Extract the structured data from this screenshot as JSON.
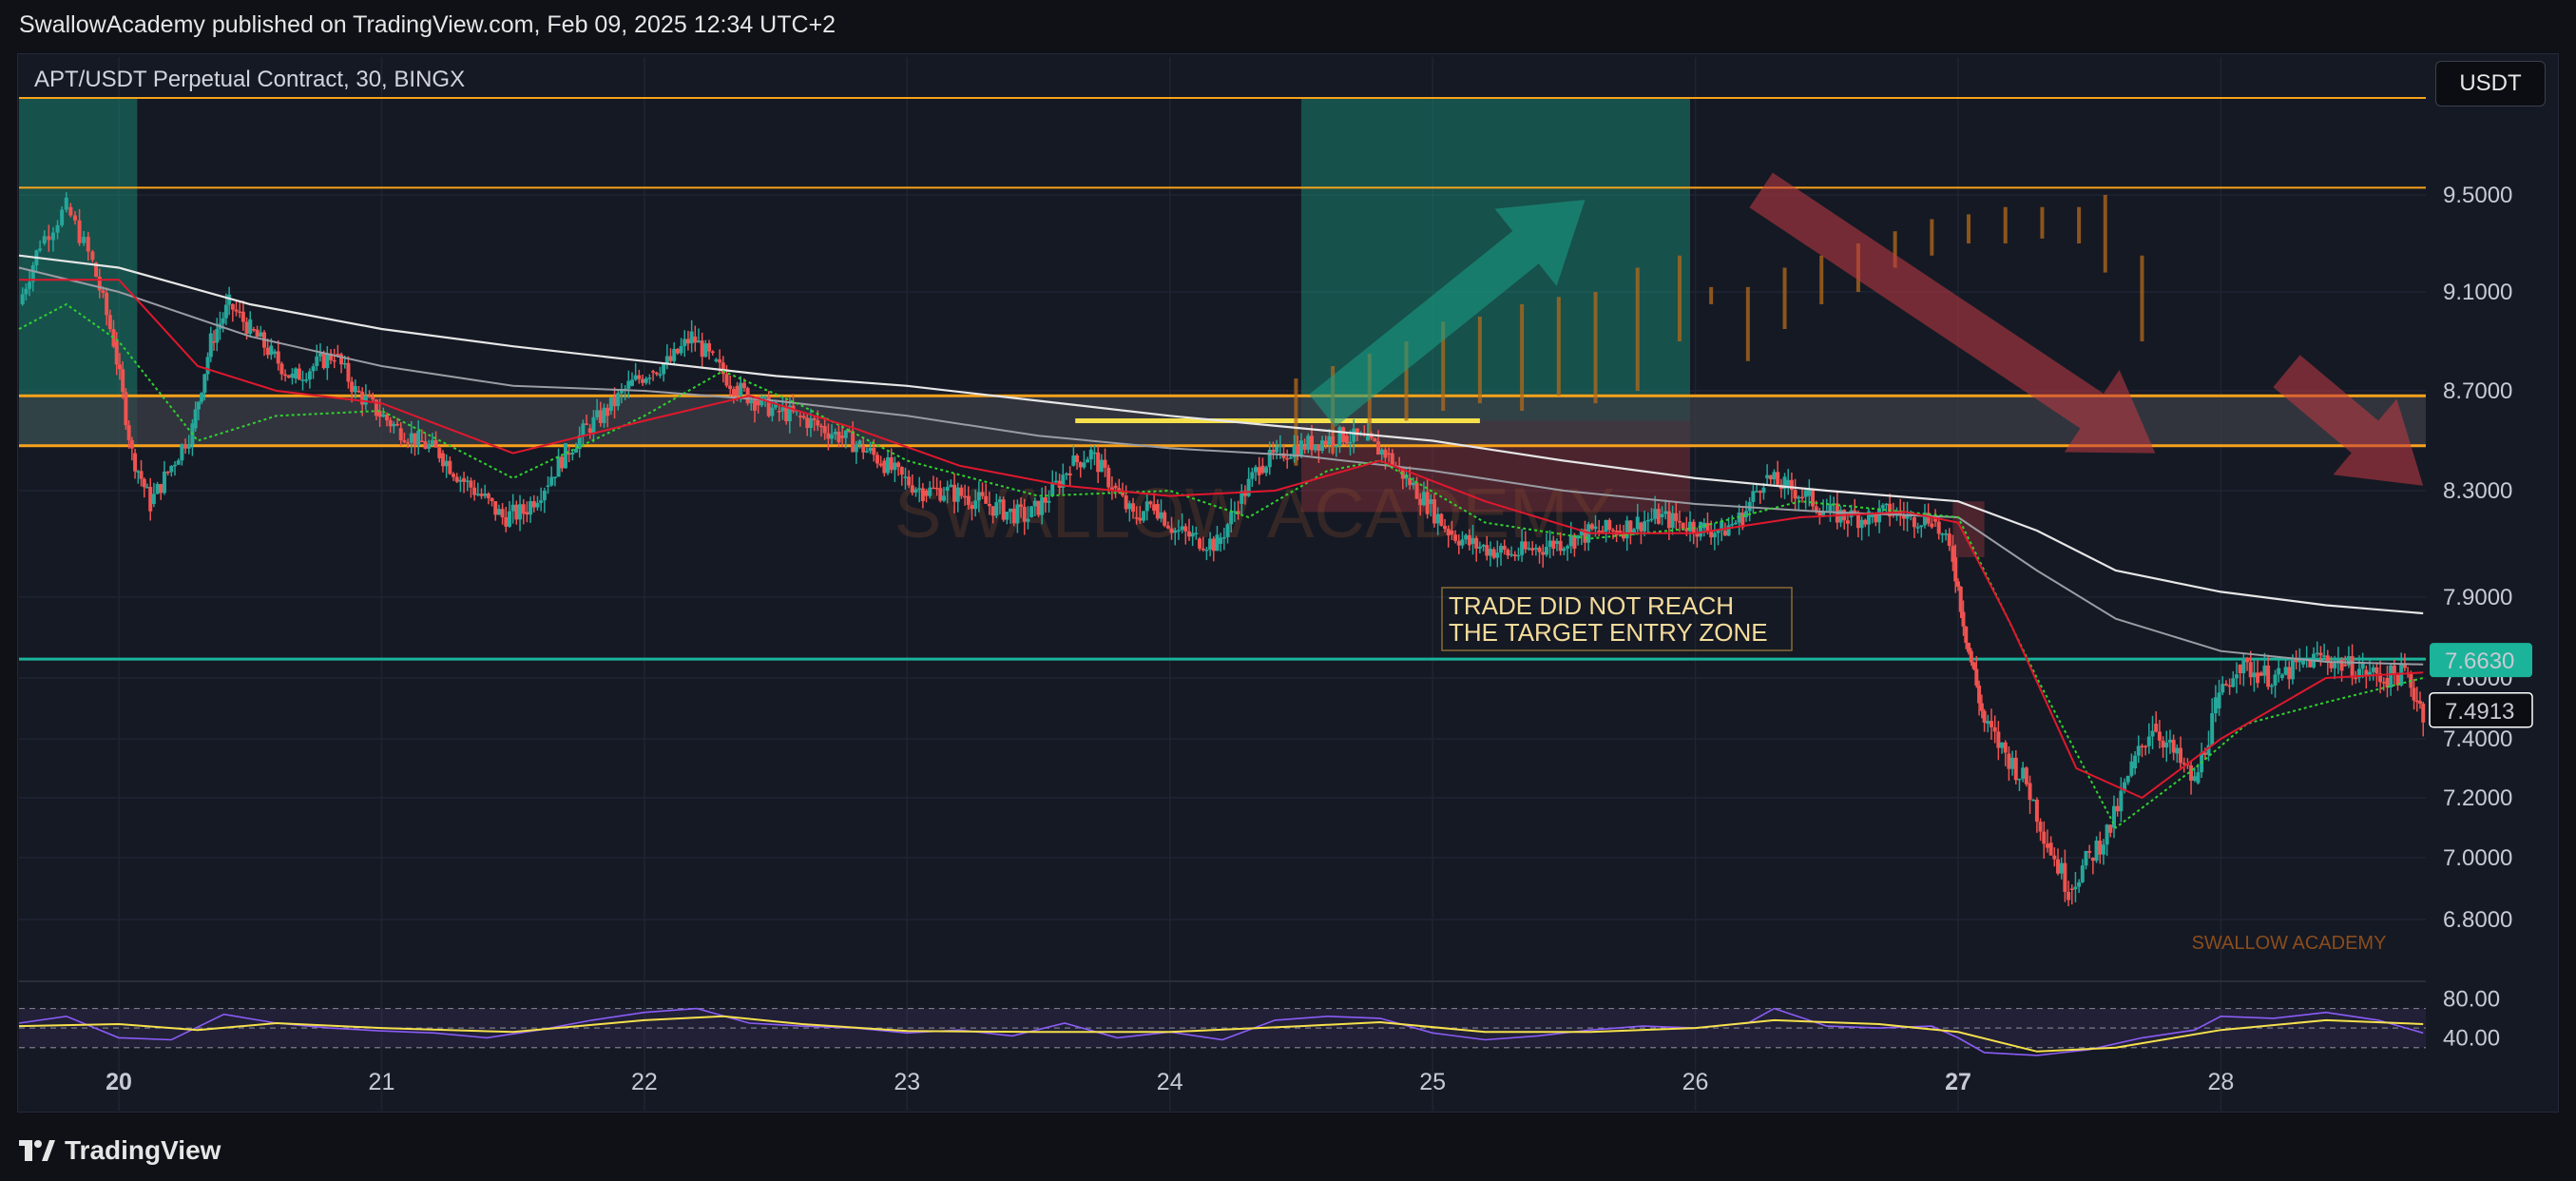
{
  "header": {
    "published_line": "SwallowAcademy published on TradingView.com, Feb 09, 2025 12:34 UTC+2"
  },
  "chart_header": {
    "symbol": "APT/USDT Perpetual Contract, 30, BINGX",
    "currency_button": "USDT"
  },
  "footer": {
    "brand": "TradingView"
  },
  "annotations": {
    "note_line1": "TRADE DID NOT REACH",
    "note_line2": "THE TARGET ENTRY ZONE",
    "watermark_center": "SWALLOW ACADEMY",
    "watermark_corner": "SWALLOW ACADEMY"
  },
  "chart_data": {
    "type": "candlestick",
    "price_axis": {
      "ticks": [
        "9.5000",
        "9.1000",
        "8.7000",
        "8.3000",
        "7.9000",
        "7.6000",
        "7.4000",
        "7.2000",
        "7.0000",
        "6.8000"
      ],
      "tick_values": [
        9.5,
        9.1,
        8.7,
        8.3,
        7.9,
        7.6,
        7.4,
        7.2,
        7.0,
        6.8
      ],
      "ylim": [
        6.7,
        9.9
      ],
      "current_price": "7.6630",
      "last_close": "7.4913"
    },
    "rsi_axis": {
      "ticks": [
        "80.00",
        "40.00"
      ],
      "tick_values": [
        80,
        40
      ],
      "ylim": [
        20,
        90
      ]
    },
    "x_axis": {
      "ticks": [
        "20",
        "21",
        "22",
        "23",
        "24",
        "25",
        "26",
        "27",
        "28"
      ],
      "day_positions": [
        20,
        21,
        22,
        23,
        24,
        25,
        26,
        27,
        28
      ],
      "xlim": [
        19.62,
        28.78
      ]
    },
    "series": {
      "close": [
        [
          19.62,
          9.05
        ],
        [
          19.7,
          9.3
        ],
        [
          19.8,
          9.45
        ],
        [
          19.9,
          9.22
        ],
        [
          19.98,
          8.9
        ],
        [
          20.05,
          8.45
        ],
        [
          20.12,
          8.25
        ],
        [
          20.2,
          8.4
        ],
        [
          20.28,
          8.55
        ],
        [
          20.35,
          8.9
        ],
        [
          20.42,
          9.05
        ],
        [
          20.5,
          8.95
        ],
        [
          20.58,
          8.85
        ],
        [
          20.66,
          8.75
        ],
        [
          20.74,
          8.8
        ],
        [
          20.82,
          8.85
        ],
        [
          20.9,
          8.7
        ],
        [
          20.98,
          8.62
        ],
        [
          21.06,
          8.55
        ],
        [
          21.14,
          8.5
        ],
        [
          21.22,
          8.45
        ],
        [
          21.3,
          8.35
        ],
        [
          21.38,
          8.28
        ],
        [
          21.46,
          8.2
        ],
        [
          21.54,
          8.22
        ],
        [
          21.62,
          8.32
        ],
        [
          21.7,
          8.45
        ],
        [
          21.78,
          8.55
        ],
        [
          21.86,
          8.62
        ],
        [
          21.94,
          8.72
        ],
        [
          22.02,
          8.78
        ],
        [
          22.1,
          8.82
        ],
        [
          22.18,
          8.92
        ],
        [
          22.26,
          8.82
        ],
        [
          22.34,
          8.72
        ],
        [
          22.42,
          8.66
        ],
        [
          22.5,
          8.62
        ],
        [
          22.58,
          8.6
        ],
        [
          22.66,
          8.56
        ],
        [
          22.74,
          8.52
        ],
        [
          22.82,
          8.48
        ],
        [
          22.9,
          8.42
        ],
        [
          22.98,
          8.35
        ],
        [
          23.06,
          8.3
        ],
        [
          23.14,
          8.3
        ],
        [
          23.22,
          8.28
        ],
        [
          23.3,
          8.25
        ],
        [
          23.38,
          8.22
        ],
        [
          23.46,
          8.2
        ],
        [
          23.54,
          8.28
        ],
        [
          23.62,
          8.4
        ],
        [
          23.7,
          8.45
        ],
        [
          23.78,
          8.32
        ],
        [
          23.86,
          8.2
        ],
        [
          23.94,
          8.25
        ],
        [
          24.02,
          8.15
        ],
        [
          24.1,
          8.12
        ],
        [
          24.18,
          8.1
        ],
        [
          24.26,
          8.25
        ],
        [
          24.34,
          8.4
        ],
        [
          24.42,
          8.45
        ],
        [
          24.5,
          8.48
        ],
        [
          24.58,
          8.5
        ],
        [
          24.66,
          8.52
        ],
        [
          24.74,
          8.5
        ],
        [
          24.82,
          8.45
        ],
        [
          24.9,
          8.35
        ],
        [
          24.98,
          8.25
        ],
        [
          25.06,
          8.15
        ],
        [
          25.14,
          8.1
        ],
        [
          25.22,
          8.08
        ],
        [
          25.3,
          8.06
        ],
        [
          25.38,
          8.08
        ],
        [
          25.46,
          8.1
        ],
        [
          25.54,
          8.12
        ],
        [
          25.62,
          8.15
        ],
        [
          25.7,
          8.15
        ],
        [
          25.78,
          8.18
        ],
        [
          25.86,
          8.2
        ],
        [
          25.94,
          8.18
        ],
        [
          26.02,
          8.16
        ],
        [
          26.1,
          8.15
        ],
        [
          26.18,
          8.2
        ],
        [
          26.26,
          8.35
        ],
        [
          26.34,
          8.32
        ],
        [
          26.42,
          8.28
        ],
        [
          26.5,
          8.22
        ],
        [
          26.58,
          8.2
        ],
        [
          26.66,
          8.2
        ],
        [
          26.74,
          8.22
        ],
        [
          26.82,
          8.2
        ],
        [
          26.9,
          8.2
        ],
        [
          26.98,
          8.05
        ],
        [
          27.04,
          7.7
        ],
        [
          27.1,
          7.45
        ],
        [
          27.18,
          7.35
        ],
        [
          27.26,
          7.25
        ],
        [
          27.34,
          7.05
        ],
        [
          27.42,
          6.9
        ],
        [
          27.5,
          7.0
        ],
        [
          27.58,
          7.1
        ],
        [
          27.66,
          7.3
        ],
        [
          27.74,
          7.45
        ],
        [
          27.82,
          7.35
        ],
        [
          27.9,
          7.25
        ],
        [
          27.98,
          7.5
        ],
        [
          28.06,
          7.65
        ],
        [
          28.14,
          7.62
        ],
        [
          28.22,
          7.6
        ],
        [
          28.3,
          7.65
        ],
        [
          28.38,
          7.68
        ],
        [
          28.46,
          7.65
        ],
        [
          28.54,
          7.63
        ],
        [
          28.62,
          7.6
        ],
        [
          28.7,
          7.62
        ],
        [
          28.77,
          7.49
        ]
      ],
      "ema_white": [
        [
          19.62,
          9.25
        ],
        [
          20.0,
          9.2
        ],
        [
          20.5,
          9.05
        ],
        [
          21.0,
          8.95
        ],
        [
          21.5,
          8.88
        ],
        [
          22.0,
          8.82
        ],
        [
          22.5,
          8.76
        ],
        [
          23.0,
          8.72
        ],
        [
          23.5,
          8.66
        ],
        [
          24.0,
          8.6
        ],
        [
          24.5,
          8.55
        ],
        [
          25.0,
          8.5
        ],
        [
          25.5,
          8.42
        ],
        [
          26.0,
          8.35
        ],
        [
          26.5,
          8.3
        ],
        [
          27.0,
          8.26
        ],
        [
          27.3,
          8.15
        ],
        [
          27.6,
          8.0
        ],
        [
          28.0,
          7.92
        ],
        [
          28.4,
          7.87
        ],
        [
          28.77,
          7.84
        ]
      ],
      "ema_grey": [
        [
          19.62,
          9.2
        ],
        [
          20.0,
          9.1
        ],
        [
          20.5,
          8.92
        ],
        [
          21.0,
          8.8
        ],
        [
          21.5,
          8.72
        ],
        [
          22.0,
          8.7
        ],
        [
          22.5,
          8.66
        ],
        [
          23.0,
          8.6
        ],
        [
          23.5,
          8.52
        ],
        [
          24.0,
          8.47
        ],
        [
          24.5,
          8.44
        ],
        [
          25.0,
          8.38
        ],
        [
          25.5,
          8.3
        ],
        [
          26.0,
          8.25
        ],
        [
          26.5,
          8.22
        ],
        [
          27.0,
          8.2
        ],
        [
          27.3,
          8.0
        ],
        [
          27.6,
          7.82
        ],
        [
          28.0,
          7.7
        ],
        [
          28.4,
          7.66
        ],
        [
          28.77,
          7.65
        ]
      ],
      "sma_green": [
        [
          19.62,
          8.95
        ],
        [
          19.8,
          9.05
        ],
        [
          20.0,
          8.9
        ],
        [
          20.3,
          8.5
        ],
        [
          20.6,
          8.6
        ],
        [
          21.0,
          8.62
        ],
        [
          21.5,
          8.35
        ],
        [
          22.0,
          8.6
        ],
        [
          22.3,
          8.78
        ],
        [
          22.6,
          8.64
        ],
        [
          23.0,
          8.42
        ],
        [
          23.5,
          8.28
        ],
        [
          24.0,
          8.3
        ],
        [
          24.3,
          8.2
        ],
        [
          24.6,
          8.38
        ],
        [
          24.8,
          8.42
        ],
        [
          25.2,
          8.18
        ],
        [
          25.6,
          8.12
        ],
        [
          26.0,
          8.16
        ],
        [
          26.4,
          8.26
        ],
        [
          26.8,
          8.22
        ],
        [
          27.0,
          8.2
        ],
        [
          27.3,
          7.6
        ],
        [
          27.6,
          7.1
        ],
        [
          27.9,
          7.3
        ],
        [
          28.1,
          7.45
        ],
        [
          28.4,
          7.52
        ],
        [
          28.77,
          7.6
        ]
      ],
      "ma_red": [
        [
          19.62,
          9.15
        ],
        [
          20.0,
          9.15
        ],
        [
          20.3,
          8.8
        ],
        [
          20.6,
          8.7
        ],
        [
          21.0,
          8.65
        ],
        [
          21.5,
          8.45
        ],
        [
          22.0,
          8.58
        ],
        [
          22.4,
          8.68
        ],
        [
          22.8,
          8.55
        ],
        [
          23.2,
          8.4
        ],
        [
          23.6,
          8.32
        ],
        [
          24.0,
          8.28
        ],
        [
          24.4,
          8.3
        ],
        [
          24.8,
          8.42
        ],
        [
          25.2,
          8.26
        ],
        [
          25.6,
          8.14
        ],
        [
          26.0,
          8.14
        ],
        [
          26.4,
          8.2
        ],
        [
          26.8,
          8.22
        ],
        [
          27.0,
          8.18
        ],
        [
          27.2,
          7.8
        ],
        [
          27.45,
          7.3
        ],
        [
          27.7,
          7.2
        ],
        [
          28.0,
          7.4
        ],
        [
          28.4,
          7.6
        ],
        [
          28.77,
          7.62
        ]
      ],
      "rsi": [
        [
          19.62,
          55
        ],
        [
          19.8,
          62
        ],
        [
          20.0,
          40
        ],
        [
          20.2,
          38
        ],
        [
          20.4,
          64
        ],
        [
          20.6,
          55
        ],
        [
          20.8,
          50
        ],
        [
          21.0,
          47
        ],
        [
          21.2,
          45
        ],
        [
          21.4,
          40
        ],
        [
          21.6,
          48
        ],
        [
          21.8,
          58
        ],
        [
          22.0,
          66
        ],
        [
          22.2,
          70
        ],
        [
          22.4,
          55
        ],
        [
          22.6,
          52
        ],
        [
          22.8,
          50
        ],
        [
          23.0,
          45
        ],
        [
          23.2,
          48
        ],
        [
          23.4,
          42
        ],
        [
          23.6,
          55
        ],
        [
          23.8,
          40
        ],
        [
          24.0,
          46
        ],
        [
          24.2,
          38
        ],
        [
          24.4,
          58
        ],
        [
          24.6,
          62
        ],
        [
          24.8,
          60
        ],
        [
          25.0,
          45
        ],
        [
          25.2,
          38
        ],
        [
          25.4,
          42
        ],
        [
          25.6,
          48
        ],
        [
          25.8,
          52
        ],
        [
          26.0,
          50
        ],
        [
          26.2,
          55
        ],
        [
          26.3,
          70
        ],
        [
          26.5,
          52
        ],
        [
          26.7,
          50
        ],
        [
          26.9,
          52
        ],
        [
          27.0,
          40
        ],
        [
          27.1,
          25
        ],
        [
          27.3,
          22
        ],
        [
          27.5,
          28
        ],
        [
          27.7,
          40
        ],
        [
          27.9,
          48
        ],
        [
          28.0,
          62
        ],
        [
          28.2,
          60
        ],
        [
          28.4,
          66
        ],
        [
          28.6,
          58
        ],
        [
          28.77,
          45
        ]
      ],
      "rsi_signal": [
        [
          19.62,
          52
        ],
        [
          20.0,
          54
        ],
        [
          20.3,
          48
        ],
        [
          20.6,
          55
        ],
        [
          21.0,
          50
        ],
        [
          21.5,
          46
        ],
        [
          22.0,
          58
        ],
        [
          22.3,
          62
        ],
        [
          22.6,
          54
        ],
        [
          23.0,
          47
        ],
        [
          23.5,
          46
        ],
        [
          24.0,
          46
        ],
        [
          24.5,
          52
        ],
        [
          24.8,
          56
        ],
        [
          25.2,
          46
        ],
        [
          25.6,
          46
        ],
        [
          26.0,
          50
        ],
        [
          26.3,
          58
        ],
        [
          26.7,
          54
        ],
        [
          27.0,
          46
        ],
        [
          27.3,
          26
        ],
        [
          27.6,
          30
        ],
        [
          28.0,
          48
        ],
        [
          28.4,
          58
        ],
        [
          28.77,
          54
        ]
      ]
    },
    "levels": {
      "resistance_top": 9.9,
      "resistance_upper": 9.53,
      "zone_top": 8.68,
      "zone_bottom": 8.48,
      "entry_line": 8.58,
      "support_line": 7.67
    },
    "zones": [
      {
        "name": "left-target-box",
        "x": [
          19.62,
          20.07
        ],
        "y": [
          8.48,
          9.9
        ]
      },
      {
        "name": "long-target-box",
        "x": [
          24.5,
          25.98
        ],
        "y": [
          8.58,
          9.9
        ]
      },
      {
        "name": "long-risk-box",
        "x": [
          24.5,
          25.98
        ],
        "y": [
          8.22,
          8.58
        ]
      },
      {
        "name": "right-risk-box",
        "x": [
          26.98,
          27.1
        ],
        "y": [
          8.05,
          8.26
        ]
      }
    ],
    "projection_bars": [
      [
        24.48,
        8.4,
        8.75
      ],
      [
        24.62,
        8.45,
        8.8
      ],
      [
        24.76,
        8.52,
        8.85
      ],
      [
        24.9,
        8.58,
        8.9
      ],
      [
        25.04,
        8.62,
        8.98
      ],
      [
        25.18,
        8.65,
        9.0
      ],
      [
        25.34,
        8.62,
        9.05
      ],
      [
        25.48,
        8.68,
        9.08
      ],
      [
        25.62,
        8.65,
        9.1
      ],
      [
        25.78,
        8.7,
        9.2
      ],
      [
        25.94,
        8.9,
        9.25
      ],
      [
        26.06,
        9.05,
        9.12
      ],
      [
        26.2,
        8.82,
        9.12
      ],
      [
        26.34,
        8.95,
        9.2
      ],
      [
        26.48,
        9.05,
        9.25
      ],
      [
        26.62,
        9.1,
        9.3
      ],
      [
        26.76,
        9.2,
        9.35
      ],
      [
        26.9,
        9.25,
        9.4
      ],
      [
        27.04,
        9.3,
        9.42
      ],
      [
        27.18,
        9.3,
        9.45
      ],
      [
        27.32,
        9.32,
        9.45
      ],
      [
        27.46,
        9.3,
        9.45
      ],
      [
        27.56,
        9.18,
        9.5
      ],
      [
        27.7,
        8.9,
        9.25
      ]
    ],
    "arrows": [
      {
        "name": "bullish-arrow",
        "from": [
          24.58,
          8.62
        ],
        "to": [
          25.58,
          9.48
        ]
      },
      {
        "name": "bearish-arrow",
        "from": [
          26.25,
          9.52
        ],
        "to": [
          27.75,
          8.45
        ]
      },
      {
        "name": "bearish-arrow-right",
        "from": [
          28.25,
          8.78
        ],
        "to": [
          28.77,
          8.32
        ]
      }
    ]
  },
  "colors": {
    "background": "#151924",
    "up": "#26a69a",
    "down": "#ef5350",
    "orange_line": "#f7a21b",
    "teal_line": "#1bb39a",
    "zone_fill": "#3b3e46",
    "entry_line": "#f5e04c",
    "ema_white": "#e6e6e6",
    "ema_grey": "#9a9ca3",
    "sma_green": "#2fd12f",
    "ma_red": "#e0182d",
    "rsi": "#8b5cf6",
    "rsi_signal": "#f5e04c",
    "note_text": "#f5dc9a",
    "current_badge": "#1bb39a"
  }
}
